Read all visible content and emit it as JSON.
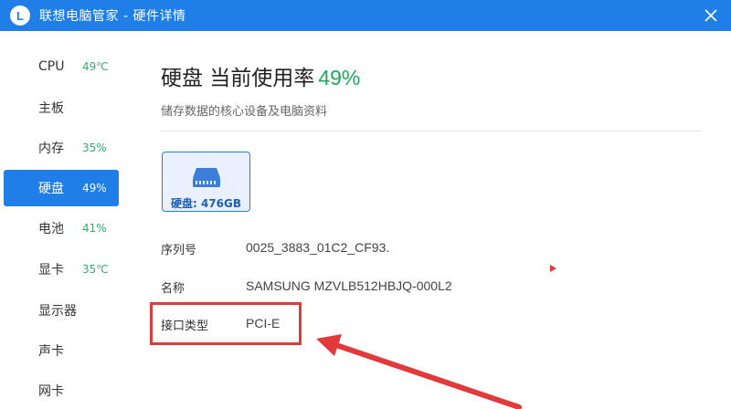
{
  "window": {
    "logo_letter": "L",
    "title": "联想电脑管家 - 硬件详情"
  },
  "sidebar": {
    "items": [
      {
        "label": "CPU",
        "value": "49℃"
      },
      {
        "label": "主板",
        "value": ""
      },
      {
        "label": "内存",
        "value": "35%"
      },
      {
        "label": "硬盘",
        "value": "49%"
      },
      {
        "label": "电池",
        "value": "41%"
      },
      {
        "label": "显卡",
        "value": "35℃"
      },
      {
        "label": "显示器",
        "value": ""
      },
      {
        "label": "声卡",
        "value": ""
      },
      {
        "label": "网卡",
        "value": ""
      }
    ],
    "active_index": 3
  },
  "main": {
    "title": "硬盘 当前使用率",
    "usage": "49%",
    "subtitle": "储存数据的核心设备及电脑资料",
    "disk_tab": "硬盘: 476GB",
    "details": [
      {
        "key": "序列号",
        "value": "0025_3883_01C2_CF93."
      },
      {
        "key": "名称",
        "value": "SAMSUNG MZVLB512HBJQ-000L2"
      },
      {
        "key": "接口类型",
        "value": "PCI-E"
      }
    ]
  },
  "colors": {
    "accent": "#1f7ee8",
    "good": "#1ba85b",
    "annotation": "#e23a3a"
  },
  "icons": [
    "logo-icon",
    "close-icon",
    "hard-disk-icon",
    "annotation-arrow-icon"
  ]
}
